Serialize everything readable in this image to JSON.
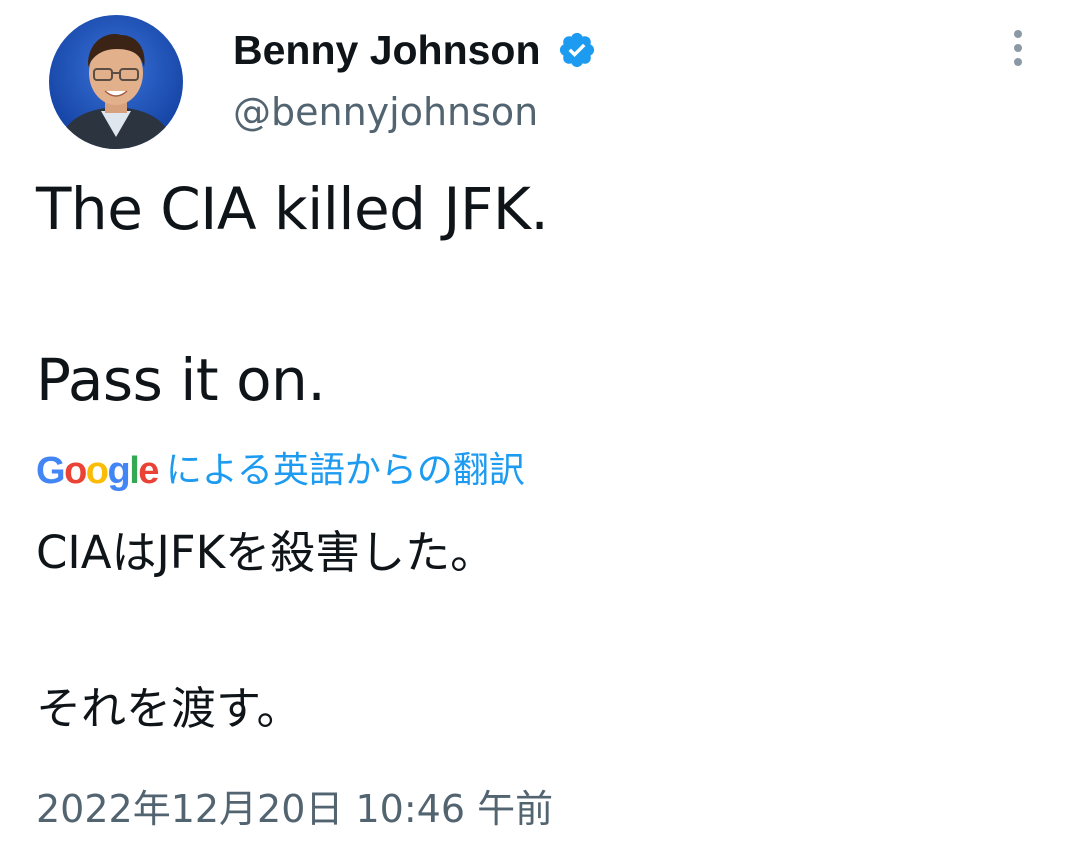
{
  "author": {
    "display_name": "Benny Johnson",
    "handle": "@bennyjohnson",
    "verified": true,
    "avatar_icon": "profile-photo",
    "badge_icon": "verified-badge-icon",
    "badge_color": "#1d9bf0"
  },
  "menu": {
    "more_icon": "more-vertical-icon"
  },
  "tweet": {
    "lines": [
      "The CIA killed JFK.",
      "Pass it on."
    ]
  },
  "translation": {
    "provider_logo": "Google",
    "attribution_text": "による英語からの翻訳",
    "attribution_color": "#1d9bf0",
    "lines": [
      "CIAはJFKを殺害した。",
      "それを渡す。"
    ]
  },
  "timestamp": "2022年12月20日 10:46 午前",
  "colors": {
    "text_primary": "#0f1419",
    "text_secondary": "#536471",
    "accent": "#1d9bf0"
  }
}
